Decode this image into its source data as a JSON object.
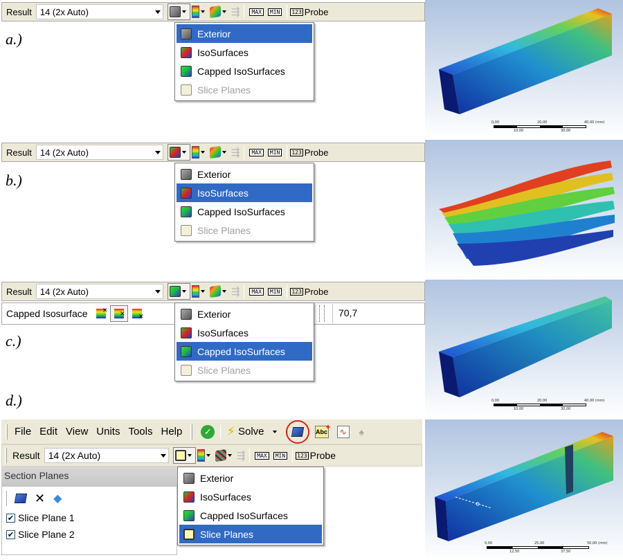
{
  "panel_labels": [
    "a.)",
    "b.)",
    "c.)",
    "d.)"
  ],
  "toolbar": {
    "result_label": "Result",
    "scale_value": "14 (2x Auto)",
    "max_label": "MAX",
    "min_label": "MIN",
    "probe_label": "Probe",
    "probe_icon_text": "123"
  },
  "menu_items": [
    "Exterior",
    "IsoSurfaces",
    "Capped IsoSurfaces",
    "Slice Planes"
  ],
  "capped_row": {
    "label": "Capped Isosurface",
    "value": "70,7"
  },
  "menubar": {
    "items": [
      "File",
      "Edit",
      "View",
      "Units",
      "Tools",
      "Help"
    ],
    "solve_label": "Solve"
  },
  "section_planes": {
    "header": "Section Planes",
    "items": [
      "Slice Plane 1",
      "Slice Plane 2"
    ]
  },
  "scalebars": {
    "a": {
      "top": [
        "0,00",
        "20,00",
        "40,00 (mm)"
      ],
      "bottom": [
        "10,00",
        "30,00"
      ]
    },
    "c": {
      "top": [
        "0,00",
        "20,00",
        "40,00 (mm)"
      ],
      "bottom": [
        "10,00",
        "30,00"
      ]
    },
    "d": {
      "top": [
        "0,00",
        "25,00",
        "50,00 (mm)"
      ],
      "bottom": [
        "12,50",
        "37,50"
      ]
    }
  },
  "colors": {
    "highlight": "#316ac5",
    "toolbar_bg": "#ece9d8",
    "viewport_bg_top": "#b0c4e0",
    "viewport_bg_bottom": "#ffffff",
    "annotation_circle": "#e02020"
  }
}
